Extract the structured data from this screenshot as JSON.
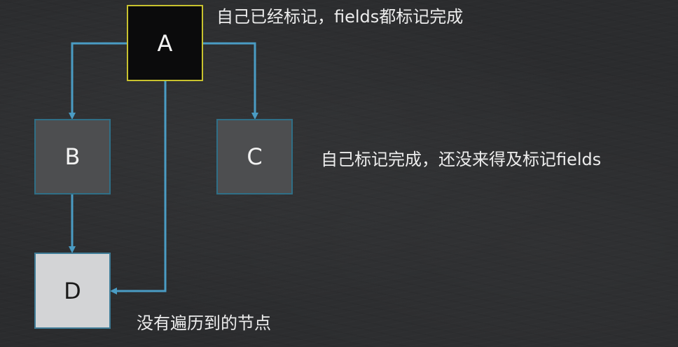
{
  "nodes": {
    "a": {
      "label": "A"
    },
    "b": {
      "label": "B"
    },
    "c": {
      "label": "C"
    },
    "d": {
      "label": "D"
    }
  },
  "captions": {
    "a": "自己已经标记，fields都标记完成",
    "c": "自己标记完成，还没来得及标记fields",
    "d": "没有遍历到的节点"
  },
  "colors": {
    "arrow": "#4a9cc4",
    "node_a_border": "#c8c22e",
    "node_a_fill": "#0b0b0c",
    "node_gray_fill": "#4d4e50",
    "node_d_fill": "#d3d4d6",
    "background": "#2b2c2e"
  }
}
